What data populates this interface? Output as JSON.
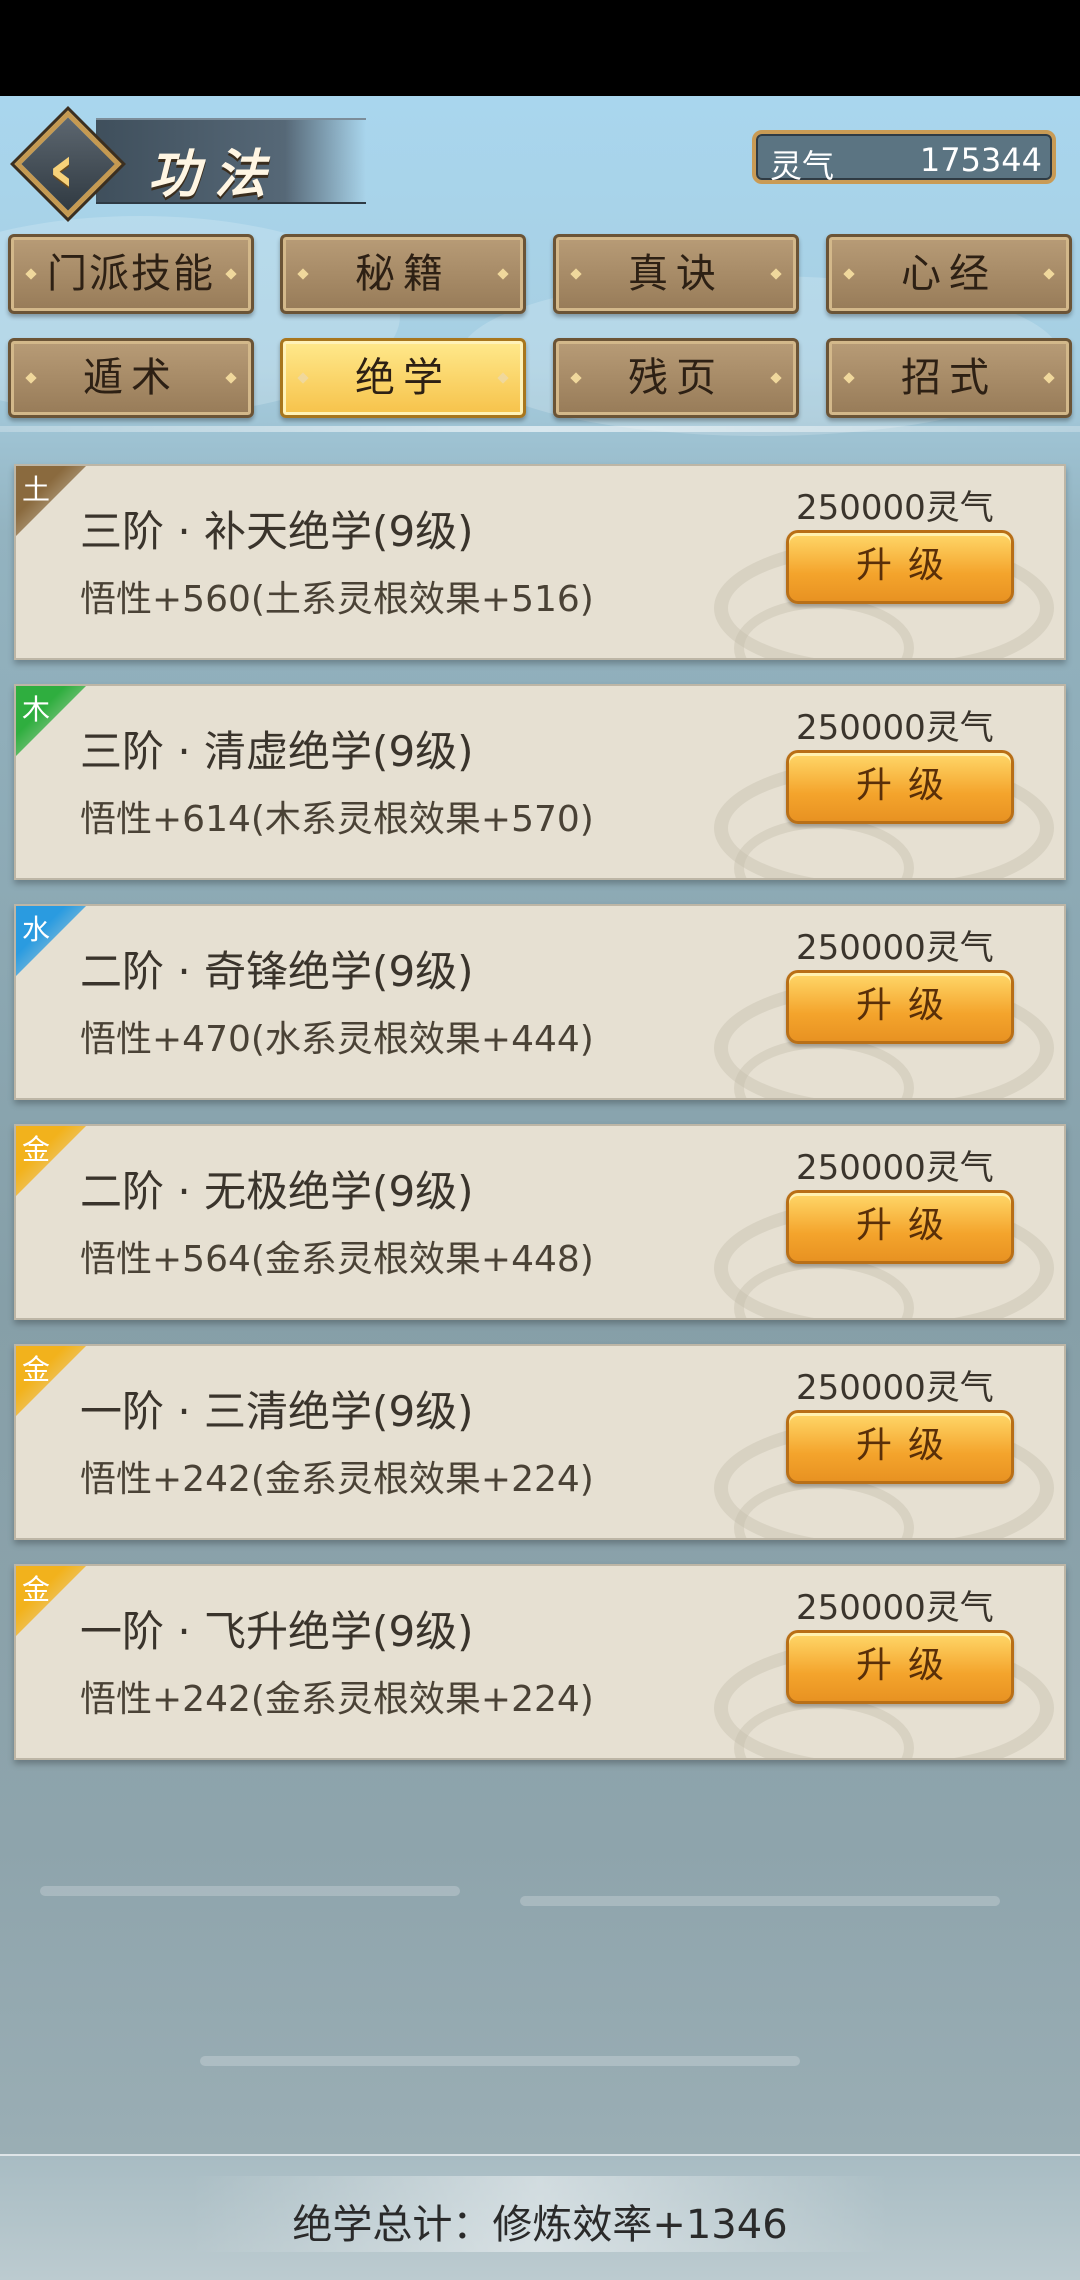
{
  "header": {
    "title": "功法",
    "lingqi_label": "灵气",
    "lingqi_value": "175344"
  },
  "tabs": [
    {
      "label": "门派技能",
      "active": false
    },
    {
      "label": "秘籍",
      "active": false
    },
    {
      "label": "真诀",
      "active": false
    },
    {
      "label": "心经",
      "active": false
    },
    {
      "label": "遁术",
      "active": false
    },
    {
      "label": "绝学",
      "active": true
    },
    {
      "label": "残页",
      "active": false
    },
    {
      "label": "招式",
      "active": false
    }
  ],
  "skills": [
    {
      "element": "土",
      "element_color": "#8a6a3e",
      "name": "三阶 · 补天绝学(9级)",
      "desc": "悟性+560(土系灵根效果+516)",
      "cost": "250000灵气",
      "button": "升级"
    },
    {
      "element": "木",
      "element_color": "#2fae3f",
      "name": "三阶 · 清虚绝学(9级)",
      "desc": "悟性+614(木系灵根效果+570)",
      "cost": "250000灵气",
      "button": "升级"
    },
    {
      "element": "水",
      "element_color": "#2a9be0",
      "name": "二阶 · 奇锋绝学(9级)",
      "desc": "悟性+470(水系灵根效果+444)",
      "cost": "250000灵气",
      "button": "升级"
    },
    {
      "element": "金",
      "element_color": "#f2b21c",
      "name": "二阶 · 无极绝学(9级)",
      "desc": "悟性+564(金系灵根效果+448)",
      "cost": "250000灵气",
      "button": "升级"
    },
    {
      "element": "金",
      "element_color": "#f2b21c",
      "name": "一阶 · 三清绝学(9级)",
      "desc": "悟性+242(金系灵根效果+224)",
      "cost": "250000灵气",
      "button": "升级"
    },
    {
      "element": "金",
      "element_color": "#f2b21c",
      "name": "一阶 · 飞升绝学(9级)",
      "desc": "悟性+242(金系灵根效果+224)",
      "cost": "250000灵气",
      "button": "升级"
    }
  ],
  "footer": {
    "summary": "绝学总计：修炼效率+1346"
  }
}
